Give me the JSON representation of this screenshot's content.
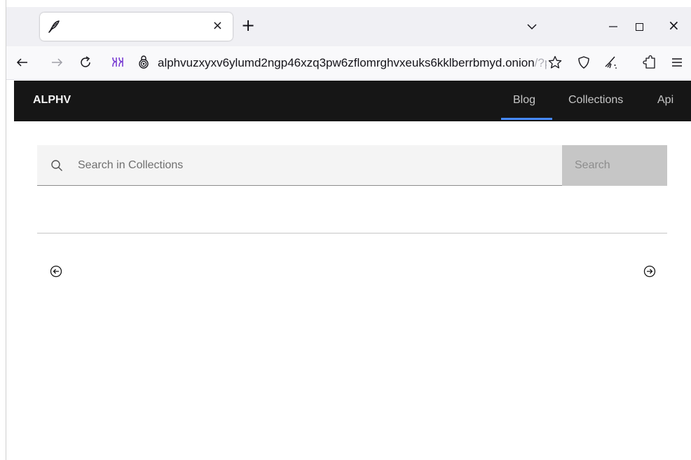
{
  "browser": {
    "tab": {
      "favicon": "quill-icon",
      "close_glyph": "×"
    },
    "new_tab_glyph": "+",
    "window_close_glyph": "×",
    "url": {
      "host": "alphvuzxyxv6ylumd2ngp46xzq3pw6zflomrghvxeuks6kklberrbmyd.onion",
      "rest": "/?p"
    }
  },
  "site": {
    "brand": "ALPHV",
    "nav": [
      {
        "label": "Blog",
        "active": true
      },
      {
        "label": "Collections",
        "active": false
      },
      {
        "label": "Api",
        "active": false
      }
    ],
    "search": {
      "placeholder": "Search in Collections",
      "button_label": "Search"
    }
  },
  "colors": {
    "header_bg": "#161616",
    "active_underline": "#4589ff",
    "search_field_bg": "#f4f4f4",
    "search_button_bg": "#c6c6c6"
  }
}
